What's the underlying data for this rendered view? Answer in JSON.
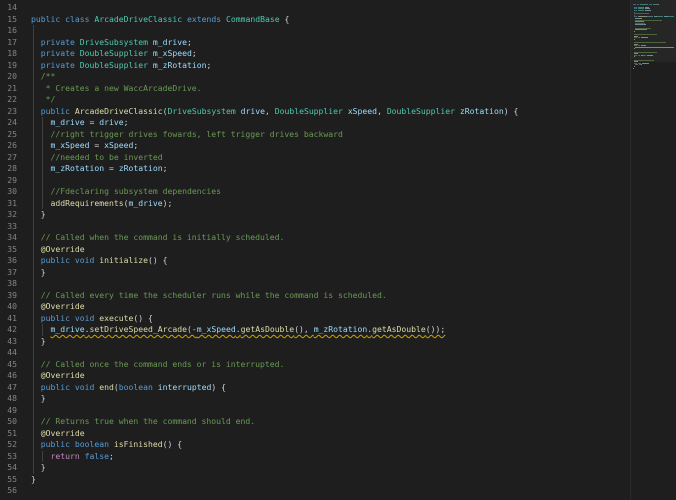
{
  "editor": {
    "language": "java",
    "colors": {
      "background": "#1e1e1e",
      "line_number": "#858585",
      "keyword": "#569cd6",
      "control_keyword": "#c586c0",
      "type": "#4ec9b0",
      "function": "#dcdcaa",
      "variable": "#9cdcfe",
      "comment": "#6a9955",
      "default": "#d4d4d4",
      "warning_squiggle": "#cca700"
    },
    "lines": [
      {
        "n": "14",
        "t": []
      },
      {
        "n": "15",
        "t": [
          [
            "kw",
            "public"
          ],
          [
            "txt",
            " "
          ],
          [
            "kw",
            "class"
          ],
          [
            "txt",
            " "
          ],
          [
            "type",
            "ArcadeDriveClassic"
          ],
          [
            "txt",
            " "
          ],
          [
            "kw",
            "extends"
          ],
          [
            "txt",
            " "
          ],
          [
            "type",
            "CommandBase"
          ],
          [
            "pun",
            " {"
          ]
        ]
      },
      {
        "n": "16",
        "t": []
      },
      {
        "n": "17",
        "t": [
          [
            "txt",
            "  "
          ],
          [
            "kw",
            "private"
          ],
          [
            "txt",
            " "
          ],
          [
            "type",
            "DriveSubsystem"
          ],
          [
            "txt",
            " "
          ],
          [
            "var",
            "m_drive"
          ],
          [
            "pun",
            ";"
          ]
        ]
      },
      {
        "n": "18",
        "t": [
          [
            "txt",
            "  "
          ],
          [
            "kw",
            "private"
          ],
          [
            "txt",
            " "
          ],
          [
            "type",
            "DoubleSupplier"
          ],
          [
            "txt",
            " "
          ],
          [
            "var",
            "m_xSpeed"
          ],
          [
            "pun",
            ";"
          ]
        ]
      },
      {
        "n": "19",
        "t": [
          [
            "txt",
            "  "
          ],
          [
            "kw",
            "private"
          ],
          [
            "txt",
            " "
          ],
          [
            "type",
            "DoubleSupplier"
          ],
          [
            "txt",
            " "
          ],
          [
            "var",
            "m_zRotation"
          ],
          [
            "pun",
            ";"
          ]
        ]
      },
      {
        "n": "20",
        "t": [
          [
            "txt",
            "  "
          ],
          [
            "com",
            "/**"
          ]
        ]
      },
      {
        "n": "21",
        "t": [
          [
            "txt",
            "  "
          ],
          [
            "com",
            " * Creates a new WaccArcadeDrive."
          ]
        ]
      },
      {
        "n": "22",
        "t": [
          [
            "txt",
            "  "
          ],
          [
            "com",
            " */"
          ]
        ]
      },
      {
        "n": "23",
        "t": [
          [
            "txt",
            "  "
          ],
          [
            "kw",
            "public"
          ],
          [
            "txt",
            " "
          ],
          [
            "fn",
            "ArcadeDriveClassic"
          ],
          [
            "pun",
            "("
          ],
          [
            "type",
            "DriveSubsystem"
          ],
          [
            "txt",
            " "
          ],
          [
            "var",
            "drive"
          ],
          [
            "pun",
            ", "
          ],
          [
            "type",
            "DoubleSupplier"
          ],
          [
            "txt",
            " "
          ],
          [
            "var",
            "xSpeed"
          ],
          [
            "pun",
            ", "
          ],
          [
            "type",
            "DoubleSupplier"
          ],
          [
            "txt",
            " "
          ],
          [
            "var",
            "zRotation"
          ],
          [
            "pun",
            ") {"
          ]
        ]
      },
      {
        "n": "24",
        "t": [
          [
            "txt",
            "    "
          ],
          [
            "var",
            "m_drive"
          ],
          [
            "pun",
            " = "
          ],
          [
            "var",
            "drive"
          ],
          [
            "pun",
            ";"
          ]
        ]
      },
      {
        "n": "25",
        "t": [
          [
            "txt",
            "    "
          ],
          [
            "com",
            "//right trigger drives fowards, left trigger drives backward"
          ]
        ]
      },
      {
        "n": "26",
        "t": [
          [
            "txt",
            "    "
          ],
          [
            "var",
            "m_xSpeed"
          ],
          [
            "pun",
            " = "
          ],
          [
            "var",
            "xSpeed"
          ],
          [
            "pun",
            ";"
          ]
        ]
      },
      {
        "n": "27",
        "t": [
          [
            "txt",
            "    "
          ],
          [
            "com",
            "//needed to be inverted"
          ]
        ]
      },
      {
        "n": "28",
        "t": [
          [
            "txt",
            "    "
          ],
          [
            "var",
            "m_zRotation"
          ],
          [
            "pun",
            " = "
          ],
          [
            "var",
            "zRotation"
          ],
          [
            "pun",
            ";"
          ]
        ]
      },
      {
        "n": "29",
        "t": []
      },
      {
        "n": "30",
        "t": [
          [
            "txt",
            "    "
          ],
          [
            "com",
            "//Fdeclaring subsystem dependencies"
          ]
        ]
      },
      {
        "n": "31",
        "t": [
          [
            "txt",
            "    "
          ],
          [
            "fn",
            "addRequirements"
          ],
          [
            "pun",
            "("
          ],
          [
            "var",
            "m_drive"
          ],
          [
            "pun",
            ");"
          ]
        ]
      },
      {
        "n": "32",
        "t": [
          [
            "txt",
            "  "
          ],
          [
            "pun",
            "}"
          ]
        ]
      },
      {
        "n": "33",
        "t": []
      },
      {
        "n": "34",
        "t": [
          [
            "txt",
            "  "
          ],
          [
            "com",
            "// Called when the command is initially scheduled."
          ]
        ]
      },
      {
        "n": "35",
        "t": [
          [
            "txt",
            "  "
          ],
          [
            "ann",
            "@Override"
          ]
        ]
      },
      {
        "n": "36",
        "t": [
          [
            "txt",
            "  "
          ],
          [
            "kw",
            "public"
          ],
          [
            "txt",
            " "
          ],
          [
            "kw",
            "void"
          ],
          [
            "txt",
            " "
          ],
          [
            "fn",
            "initialize"
          ],
          [
            "pun",
            "() {"
          ]
        ]
      },
      {
        "n": "37",
        "t": [
          [
            "txt",
            "  "
          ],
          [
            "pun",
            "}"
          ]
        ]
      },
      {
        "n": "38",
        "t": []
      },
      {
        "n": "39",
        "t": [
          [
            "txt",
            "  "
          ],
          [
            "com",
            "// Called every time the scheduler runs while the command is scheduled."
          ]
        ]
      },
      {
        "n": "40",
        "t": [
          [
            "txt",
            "  "
          ],
          [
            "ann",
            "@Override"
          ]
        ]
      },
      {
        "n": "41",
        "t": [
          [
            "txt",
            "  "
          ],
          [
            "kw",
            "public"
          ],
          [
            "txt",
            " "
          ],
          [
            "kw",
            "void"
          ],
          [
            "txt",
            " "
          ],
          [
            "fn",
            "execute"
          ],
          [
            "pun",
            "() {"
          ]
        ]
      },
      {
        "n": "42",
        "t": [
          [
            "txt",
            "    "
          ],
          [
            "var",
            "m_drive",
            "squig"
          ],
          [
            "pun",
            ".",
            "squig"
          ],
          [
            "fn",
            "setDriveSpeed_Arcade",
            "squig"
          ],
          [
            "pun",
            "(-",
            "squig"
          ],
          [
            "var",
            "m_xSpeed",
            "squig"
          ],
          [
            "pun",
            ".",
            "squig"
          ],
          [
            "fn",
            "getAsDouble",
            "squig"
          ],
          [
            "pun",
            "(), ",
            "squig"
          ],
          [
            "var",
            "m_zRotation",
            "squig"
          ],
          [
            "pun",
            ".",
            "squig"
          ],
          [
            "fn",
            "getAsDouble",
            "squig"
          ],
          [
            "pun",
            "());",
            "squig"
          ]
        ]
      },
      {
        "n": "43",
        "t": [
          [
            "txt",
            "  "
          ],
          [
            "pun",
            "}"
          ]
        ]
      },
      {
        "n": "44",
        "t": []
      },
      {
        "n": "45",
        "t": [
          [
            "txt",
            "  "
          ],
          [
            "com",
            "// Called once the command ends or is interrupted."
          ]
        ]
      },
      {
        "n": "46",
        "t": [
          [
            "txt",
            "  "
          ],
          [
            "ann",
            "@Override"
          ]
        ]
      },
      {
        "n": "47",
        "t": [
          [
            "txt",
            "  "
          ],
          [
            "kw",
            "public"
          ],
          [
            "txt",
            " "
          ],
          [
            "kw",
            "void"
          ],
          [
            "txt",
            " "
          ],
          [
            "fn",
            "end"
          ],
          [
            "pun",
            "("
          ],
          [
            "kw",
            "boolean"
          ],
          [
            "txt",
            " "
          ],
          [
            "var",
            "interrupted"
          ],
          [
            "pun",
            ") {"
          ]
        ]
      },
      {
        "n": "48",
        "t": [
          [
            "txt",
            "  "
          ],
          [
            "pun",
            "}"
          ]
        ]
      },
      {
        "n": "49",
        "t": []
      },
      {
        "n": "50",
        "t": [
          [
            "txt",
            "  "
          ],
          [
            "com",
            "// Returns true when the command should end."
          ]
        ]
      },
      {
        "n": "51",
        "t": [
          [
            "txt",
            "  "
          ],
          [
            "ann",
            "@Override"
          ]
        ]
      },
      {
        "n": "52",
        "t": [
          [
            "txt",
            "  "
          ],
          [
            "kw",
            "public"
          ],
          [
            "txt",
            " "
          ],
          [
            "kw",
            "boolean"
          ],
          [
            "txt",
            " "
          ],
          [
            "fn",
            "isFinished"
          ],
          [
            "pun",
            "() {"
          ]
        ]
      },
      {
        "n": "53",
        "t": [
          [
            "txt",
            "    "
          ],
          [
            "flow",
            "return"
          ],
          [
            "txt",
            " "
          ],
          [
            "kw",
            "false"
          ],
          [
            "pun",
            ";"
          ]
        ]
      },
      {
        "n": "54",
        "t": [
          [
            "txt",
            "  "
          ],
          [
            "pun",
            "}"
          ]
        ]
      },
      {
        "n": "55",
        "t": [
          [
            "pun",
            "}"
          ]
        ]
      },
      {
        "n": "56",
        "t": []
      }
    ]
  }
}
